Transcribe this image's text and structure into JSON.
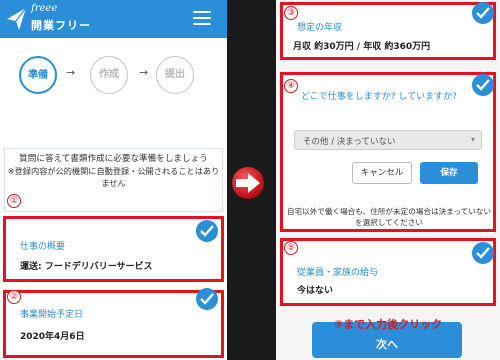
{
  "app": {
    "logo_script": "freee",
    "logo_name": "開業フリー"
  },
  "steps": [
    {
      "label": "準備",
      "state": "active"
    },
    {
      "label": "作成",
      "state": "inactive"
    },
    {
      "label": "提出",
      "state": "inactive"
    }
  ],
  "intro": {
    "line1": "質問に答えて書類作成に必要な準備をしましょう",
    "note": "※登録内容が公的機関に自動登録・公開されることはありません"
  },
  "left_cards": [
    {
      "number": "①",
      "label": "仕事の概要",
      "value": "運送: フードデリバリーサービス"
    },
    {
      "number": "②",
      "label": "事業開始予定日",
      "value": "2020年4月6日"
    }
  ],
  "right_cards": [
    {
      "number": "③",
      "label": "想定の年収",
      "value": "月収 約30万円 / 年収 約360万円"
    },
    {
      "number": "④",
      "label": "どこで仕事をしますか? していますか?",
      "value": ""
    },
    {
      "number": "⑤",
      "label": "従業員・家族の給与",
      "value": "今はない"
    }
  ],
  "location_select": {
    "value": "その他 / 決まっていない"
  },
  "buttons": {
    "cancel": "キャンセル",
    "save": "保存",
    "next": "次へ"
  },
  "helper_text": "自宅以外で働く場合も、住所が未定の場合は決まっていないを選択してください",
  "annotation": "⑤まで入力後クリック",
  "colors": {
    "brand_blue": "#2a8fd8",
    "highlight_red": "#e3141f"
  }
}
